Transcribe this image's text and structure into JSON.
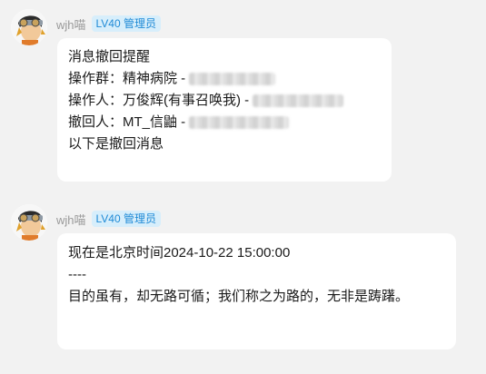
{
  "messages": [
    {
      "sender": {
        "name": "wjh喵",
        "badge": "LV40 管理员"
      },
      "lines": [
        {
          "text": "消息撤回提醒"
        },
        {
          "text": "操作群：精神病院 - "
        },
        {
          "text": "操作人：万俊辉(有事召唤我) - "
        },
        {
          "text": "撤回人：MT_信鼬 - "
        },
        {
          "text": "以下是撤回消息"
        }
      ]
    },
    {
      "sender": {
        "name": "wjh喵",
        "badge": "LV40 管理员"
      },
      "lines": [
        {
          "text": "现在是北京时间2024-10-22 15:00:00"
        },
        {
          "text": "----"
        },
        {
          "text": "目的虽有，却无路可循；我们称之为路的，无非是踌躇。"
        }
      ]
    }
  ],
  "colors": {
    "background": "#f2f2f2",
    "bubble": "#ffffff",
    "badge_bg": "#d7eefb",
    "badge_text": "#1f8ad6",
    "nickname": "#9a9a9a"
  },
  "icons": {
    "avatar": "cartoon-avatar-icon"
  }
}
